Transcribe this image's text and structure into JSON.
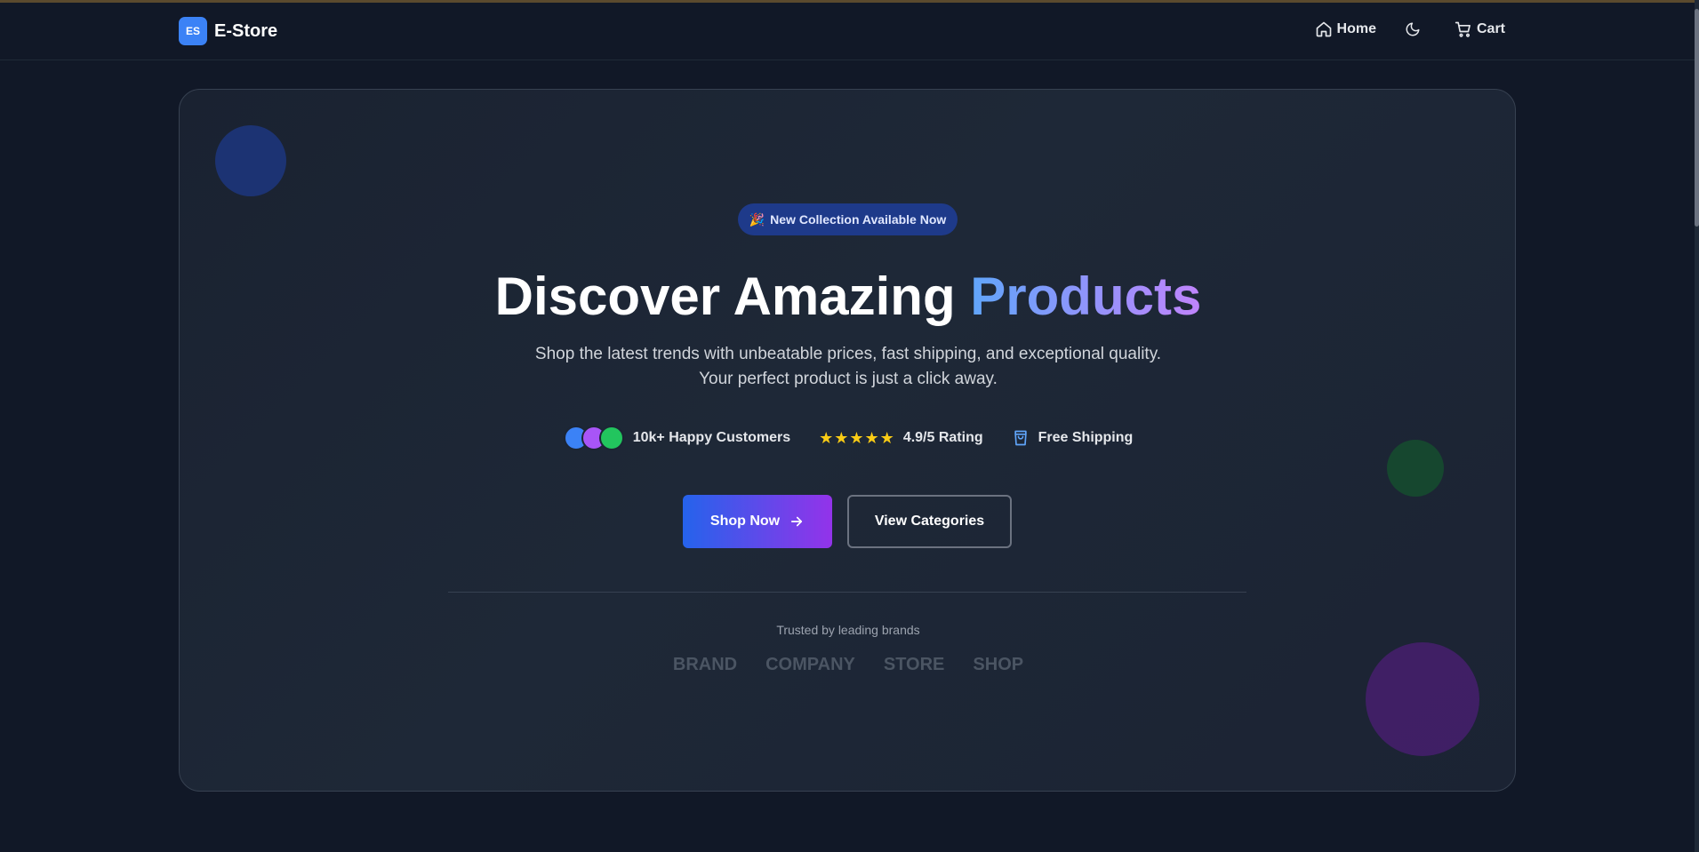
{
  "nav": {
    "logo_badge": "ES",
    "logo_text": "E-Store",
    "home_label": "Home",
    "cart_label": "Cart"
  },
  "hero": {
    "badge_emoji": "🎉",
    "badge_text": "New Collection Available Now",
    "headline_main": "Discover Amazing ",
    "headline_accent": "Products",
    "subtext_line1": "Shop the latest trends with unbeatable prices, fast shipping, and exceptional quality.",
    "subtext_line2": "Your perfect product is just a click away.",
    "stats": {
      "customers": "10k+ Happy Customers",
      "rating": "4.9/5 Rating",
      "rating_stars": 5,
      "shipping": "Free Shipping"
    },
    "primary_button": "Shop Now",
    "secondary_button": "View Categories",
    "trusted_text": "Trusted by leading brands",
    "brands": [
      "BRAND",
      "COMPANY",
      "STORE",
      "SHOP"
    ]
  },
  "colors": {
    "background": "#111827",
    "accent_blue": "#3b82f6",
    "accent_purple": "#9333ea",
    "star": "#facc15",
    "avatars": [
      "#3b82f6",
      "#a855f7",
      "#22c55e"
    ]
  },
  "icons": [
    "home-icon",
    "moon-icon",
    "cart-icon",
    "star-icon",
    "shopping-bag-icon",
    "arrow-right-icon"
  ]
}
